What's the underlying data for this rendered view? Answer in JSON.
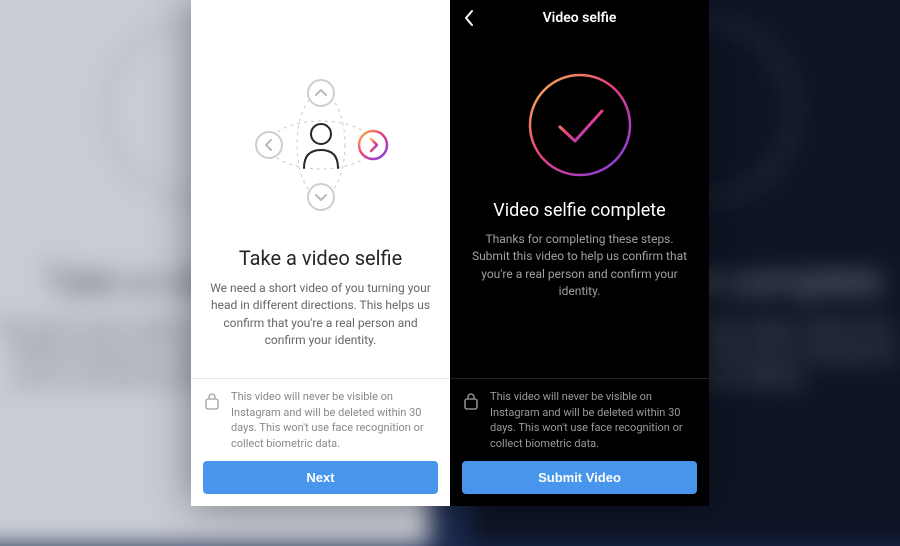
{
  "colors": {
    "accent": "#4796eb",
    "gradStart": "#f6c24b",
    "gradMid": "#ec3e7b",
    "gradEnd": "#7b3ff2"
  },
  "leftPane": {
    "topbarTitle": "",
    "title": "Take a video selfie",
    "description": "We need a short video of you turning your head in different directions. This helps us confirm that you're a real person and confirm your identity.",
    "notice": "This video will never be visible on Instagram and will be deleted within 30 days. This won't use face recognition or collect biometric data.",
    "buttonLabel": "Next"
  },
  "rightPane": {
    "topbarTitle": "Video selfie",
    "title": "Video selfie complete",
    "description": "Thanks for completing these steps. Submit this video to help us confirm that you're a real person and confirm your identity.",
    "notice": "This video will never be visible on Instagram and will be deleted within 30 days. This won't use face recognition or collect biometric data.",
    "buttonLabel": "Submit Video"
  },
  "bg": {
    "leftTitle": "Take a video selfie",
    "leftText": "We need a short video of you turning your head in different directions. This helps us confirm that you're a real person and confirm your identity.",
    "rightTitle": "Video selfie complete",
    "rightText": "Thanks for completing these steps. Submit this video to help us confirm that you're a real person and confirm your identity."
  }
}
